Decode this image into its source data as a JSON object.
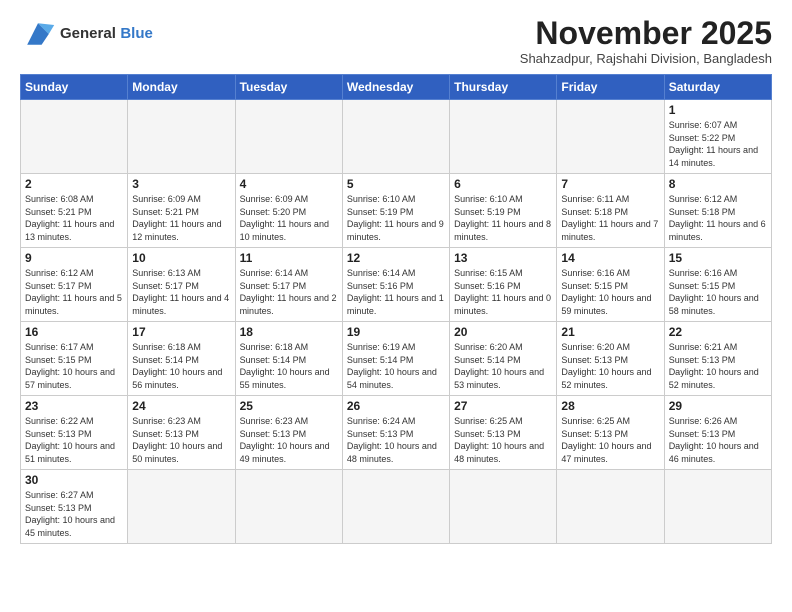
{
  "logo": {
    "line1": "General",
    "line2": "Blue"
  },
  "title": "November 2025",
  "subtitle": "Shahzadpur, Rajshahi Division, Bangladesh",
  "days_of_week": [
    "Sunday",
    "Monday",
    "Tuesday",
    "Wednesday",
    "Thursday",
    "Friday",
    "Saturday"
  ],
  "weeks": [
    [
      {
        "day": "",
        "info": ""
      },
      {
        "day": "",
        "info": ""
      },
      {
        "day": "",
        "info": ""
      },
      {
        "day": "",
        "info": ""
      },
      {
        "day": "",
        "info": ""
      },
      {
        "day": "",
        "info": ""
      },
      {
        "day": "1",
        "info": "Sunrise: 6:07 AM\nSunset: 5:22 PM\nDaylight: 11 hours and 14 minutes."
      }
    ],
    [
      {
        "day": "2",
        "info": "Sunrise: 6:08 AM\nSunset: 5:21 PM\nDaylight: 11 hours and 13 minutes."
      },
      {
        "day": "3",
        "info": "Sunrise: 6:09 AM\nSunset: 5:21 PM\nDaylight: 11 hours and 12 minutes."
      },
      {
        "day": "4",
        "info": "Sunrise: 6:09 AM\nSunset: 5:20 PM\nDaylight: 11 hours and 10 minutes."
      },
      {
        "day": "5",
        "info": "Sunrise: 6:10 AM\nSunset: 5:19 PM\nDaylight: 11 hours and 9 minutes."
      },
      {
        "day": "6",
        "info": "Sunrise: 6:10 AM\nSunset: 5:19 PM\nDaylight: 11 hours and 8 minutes."
      },
      {
        "day": "7",
        "info": "Sunrise: 6:11 AM\nSunset: 5:18 PM\nDaylight: 11 hours and 7 minutes."
      },
      {
        "day": "8",
        "info": "Sunrise: 6:12 AM\nSunset: 5:18 PM\nDaylight: 11 hours and 6 minutes."
      }
    ],
    [
      {
        "day": "9",
        "info": "Sunrise: 6:12 AM\nSunset: 5:17 PM\nDaylight: 11 hours and 5 minutes."
      },
      {
        "day": "10",
        "info": "Sunrise: 6:13 AM\nSunset: 5:17 PM\nDaylight: 11 hours and 4 minutes."
      },
      {
        "day": "11",
        "info": "Sunrise: 6:14 AM\nSunset: 5:17 PM\nDaylight: 11 hours and 2 minutes."
      },
      {
        "day": "12",
        "info": "Sunrise: 6:14 AM\nSunset: 5:16 PM\nDaylight: 11 hours and 1 minute."
      },
      {
        "day": "13",
        "info": "Sunrise: 6:15 AM\nSunset: 5:16 PM\nDaylight: 11 hours and 0 minutes."
      },
      {
        "day": "14",
        "info": "Sunrise: 6:16 AM\nSunset: 5:15 PM\nDaylight: 10 hours and 59 minutes."
      },
      {
        "day": "15",
        "info": "Sunrise: 6:16 AM\nSunset: 5:15 PM\nDaylight: 10 hours and 58 minutes."
      }
    ],
    [
      {
        "day": "16",
        "info": "Sunrise: 6:17 AM\nSunset: 5:15 PM\nDaylight: 10 hours and 57 minutes."
      },
      {
        "day": "17",
        "info": "Sunrise: 6:18 AM\nSunset: 5:14 PM\nDaylight: 10 hours and 56 minutes."
      },
      {
        "day": "18",
        "info": "Sunrise: 6:18 AM\nSunset: 5:14 PM\nDaylight: 10 hours and 55 minutes."
      },
      {
        "day": "19",
        "info": "Sunrise: 6:19 AM\nSunset: 5:14 PM\nDaylight: 10 hours and 54 minutes."
      },
      {
        "day": "20",
        "info": "Sunrise: 6:20 AM\nSunset: 5:14 PM\nDaylight: 10 hours and 53 minutes."
      },
      {
        "day": "21",
        "info": "Sunrise: 6:20 AM\nSunset: 5:13 PM\nDaylight: 10 hours and 52 minutes."
      },
      {
        "day": "22",
        "info": "Sunrise: 6:21 AM\nSunset: 5:13 PM\nDaylight: 10 hours and 52 minutes."
      }
    ],
    [
      {
        "day": "23",
        "info": "Sunrise: 6:22 AM\nSunset: 5:13 PM\nDaylight: 10 hours and 51 minutes."
      },
      {
        "day": "24",
        "info": "Sunrise: 6:23 AM\nSunset: 5:13 PM\nDaylight: 10 hours and 50 minutes."
      },
      {
        "day": "25",
        "info": "Sunrise: 6:23 AM\nSunset: 5:13 PM\nDaylight: 10 hours and 49 minutes."
      },
      {
        "day": "26",
        "info": "Sunrise: 6:24 AM\nSunset: 5:13 PM\nDaylight: 10 hours and 48 minutes."
      },
      {
        "day": "27",
        "info": "Sunrise: 6:25 AM\nSunset: 5:13 PM\nDaylight: 10 hours and 48 minutes."
      },
      {
        "day": "28",
        "info": "Sunrise: 6:25 AM\nSunset: 5:13 PM\nDaylight: 10 hours and 47 minutes."
      },
      {
        "day": "29",
        "info": "Sunrise: 6:26 AM\nSunset: 5:13 PM\nDaylight: 10 hours and 46 minutes."
      }
    ],
    [
      {
        "day": "30",
        "info": "Sunrise: 6:27 AM\nSunset: 5:13 PM\nDaylight: 10 hours and 45 minutes."
      },
      {
        "day": "",
        "info": ""
      },
      {
        "day": "",
        "info": ""
      },
      {
        "day": "",
        "info": ""
      },
      {
        "day": "",
        "info": ""
      },
      {
        "day": "",
        "info": ""
      },
      {
        "day": "",
        "info": ""
      }
    ]
  ]
}
